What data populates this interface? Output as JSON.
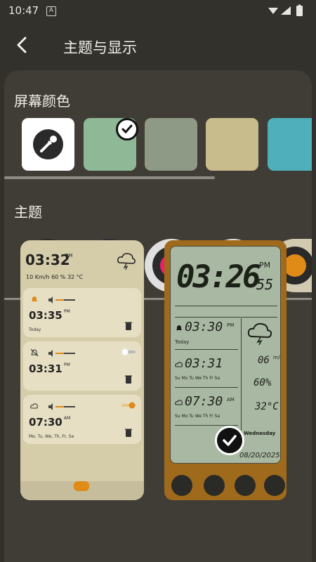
{
  "status_bar": {
    "time": "10:47",
    "notif_icon": "A"
  },
  "header": {
    "title": "主题与显示",
    "back_icon": "chevron-left-icon"
  },
  "sections": {
    "screen_color": "屏幕颜色",
    "theme": "主题"
  },
  "screen_colors": [
    {
      "type": "picker",
      "color": "#ffffff",
      "icon": "eyedropper-icon"
    },
    {
      "type": "color",
      "color": "#8fb896",
      "selected": true
    },
    {
      "type": "color",
      "color": "#8f9a86"
    },
    {
      "type": "color",
      "color": "#c8bb8c"
    },
    {
      "type": "color",
      "color": "#4fb0bb"
    }
  ],
  "themes": [
    {
      "outer": "#2a2926",
      "ring": "#d6d0c0",
      "inner": "#f28c18",
      "selected": true
    },
    {
      "outer": "#2c2d36",
      "ring": "#e6e6ea",
      "inner": "#34e63c"
    },
    {
      "outer": "#e0e0e0",
      "ring": "#2a2a2a",
      "inner": "#ee1e6a"
    },
    {
      "outer": "#e0e0e0",
      "ring": "#2a2a2a",
      "inner": "#0f9a8c"
    },
    {
      "outer": "#d2cab0",
      "ring": "#2a2a2a",
      "inner": "#e08a18"
    }
  ],
  "preview_light": {
    "time": "03:32",
    "ampm": "PM",
    "weather": "10 Km/h   60 %   32 °C",
    "alarms": [
      {
        "time": "03:35",
        "ampm": "PM",
        "days": "Today"
      },
      {
        "time": "03:31",
        "ampm": "PM",
        "days": ""
      },
      {
        "time": "07:30",
        "ampm": "AM",
        "days": "Mo, Tu, We, Th, Fr, Sa"
      }
    ]
  },
  "preview_dark": {
    "time": "03:26",
    "sec": "55",
    "ampm": "PM",
    "rows": [
      {
        "time": "03:30",
        "ampm": "PM",
        "label": "Today"
      },
      {
        "time": "03:31",
        "ampm": "",
        "label": "Su Mo Tu We Th Fr Sa"
      },
      {
        "time": "07:30",
        "ampm": "AM",
        "label": "Su Mo Tu We Th Fr Sa"
      }
    ],
    "right_values": [
      "06",
      "60%",
      "32°C"
    ],
    "right_units": [
      "m/h",
      ""
    ],
    "weekday": "Wednesday",
    "date": "08/20/2025"
  }
}
